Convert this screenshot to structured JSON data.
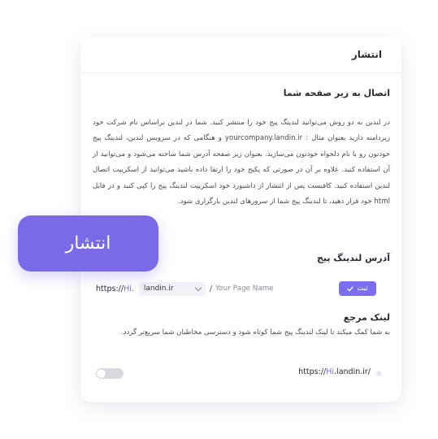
{
  "colors": {
    "accent": "#7b6ae8",
    "button": "#7c6cf0",
    "toggle_off": "#d9d9df"
  },
  "card": {
    "title": "انتشار",
    "subdomain_section": {
      "title": "اتصال به زیر صفحه شما",
      "description": "در لندین به دو روش می‌توانید لندینگ پیج خود را منتشر کنید. شما در لندین براساس نام شرکت خود زیردامنه دارید بعنوان مثال : yourcompany.landin.ir و هنگامی که در سرویس لندین، لندینگ پیج خودتون رو با نام دلخواه خودتون می‌سازید. بعنوان زیر صفحه آدرس شما ساخته می‌شود و می‌توانید از آن استفاده کنید. علاوه بر آن در صورتی که پکیج خود را ارتقا داده باشید می‌توانید از اسکریپت اتصال لندین استفاده کنید. کافیست پس از انتشار از داشبورد خود اسکریپت لندینگ پیج را کپی کنید و در فایل html خود قرار دهید، تا لندینگ پیج شما از سرورهای لندین بارگزاری شود."
    },
    "address_section": {
      "title": "آدرس لندینگ پیج",
      "protocol_prefix": "https://",
      "subdomain": "Hi.",
      "domain_value": "landin.ir",
      "slash": "/",
      "page_placeholder": "Your Page Name",
      "submit_label": "ثبت",
      "submit_icon": "check-icon"
    },
    "reference_section": {
      "title": "لینک مرجع",
      "description": "به شما کمک میکند تا لینک لندینگ پیج شما کوتاه شود و دسترسی مخاطبان شما سریع‌تر گردد.",
      "link_prefix": "https://",
      "link_sub": "Hi",
      "link_suffix": ".landin.ir/",
      "toggle_on": false
    }
  },
  "badge": {
    "label": "انتشار"
  }
}
